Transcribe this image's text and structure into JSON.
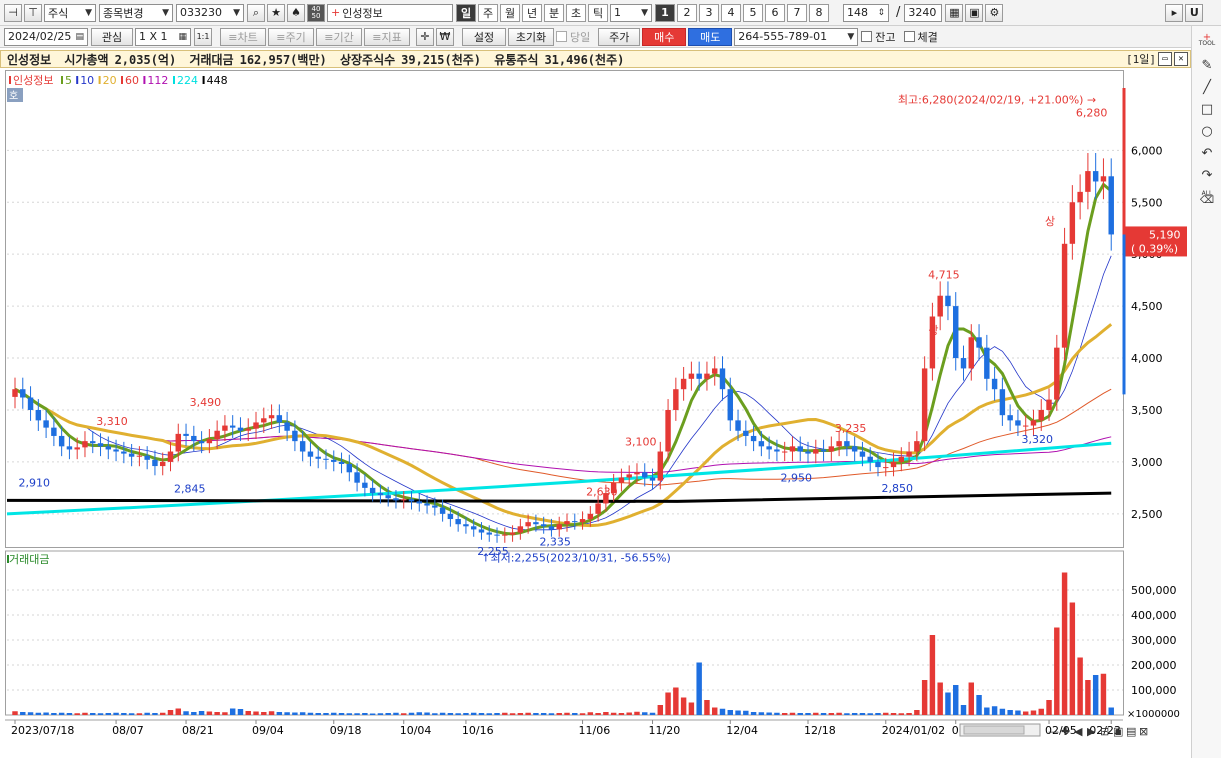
{
  "toolbar1": {
    "market_type": "주식",
    "change_item": "종목변경",
    "code": "033230",
    "stock_name": "인성정보",
    "ratio_icon_top": "40",
    "ratio_icon_bottom": "50",
    "periods": [
      "일",
      "주",
      "월",
      "년",
      "분",
      "초",
      "틱"
    ],
    "period_value": "1",
    "nums": [
      "1",
      "2",
      "3",
      "4",
      "5",
      "6",
      "7",
      "8"
    ],
    "count": "148",
    "slash": "/",
    "total": "3240",
    "u_button": "U"
  },
  "toolbar2": {
    "date": "2024/02/25",
    "interest": "관심",
    "layout": "1 X 1",
    "one_to_one": "1:1",
    "chart_btn": "≡차트",
    "period_btn": "≡주기",
    "range_btn": "≡기간",
    "indicator_btn": "≡지표",
    "won": "₩",
    "setting": "설정",
    "reset": "초기화",
    "sameday": "당일",
    "price": "주가",
    "buy": "매수",
    "sell": "매도",
    "account": "264-555-789-01",
    "balance": "잔고",
    "executed": "체결"
  },
  "infobar": {
    "name": "인성정보",
    "cap_label": "시가총액",
    "cap_value": "2,035(억)",
    "trade_label": "거래대금",
    "trade_value": "162,957(백만)",
    "listed_label": "상장주식수",
    "listed_value": "39,215(천주)",
    "float_label": "유통주식",
    "float_value": "31,496(천주)",
    "period_tag": "[1일]"
  },
  "chart_data": [
    {
      "type": "candlestick",
      "title": "인성정보",
      "legend": [
        "인성정보",
        "5",
        "10",
        "20",
        "60",
        "112",
        "224",
        "448"
      ],
      "ylim": [
        2200,
        6600
      ],
      "y_ticks": [
        2500,
        3000,
        3500,
        4000,
        4500,
        5000,
        5500,
        6000
      ],
      "x_labels": [
        "2023/07/18",
        "08/07",
        "08/21",
        "09/04",
        "09/18",
        "10/04",
        "10/16",
        "11/06",
        "11/20",
        "12/04",
        "12/18",
        "2024/01/02",
        "01/15",
        "02/05",
        "02/23"
      ],
      "annotations": [
        {
          "text": "최고:6,280(2024/02/19, +21.00%)",
          "color": "red"
        },
        {
          "text": "최저:2,255(2023/10/31, -56.55%)",
          "color": "blue"
        },
        {
          "text": "3,310",
          "color": "red"
        },
        {
          "text": "3,490",
          "color": "red"
        },
        {
          "text": "2,910",
          "color": "blue"
        },
        {
          "text": "2,845",
          "color": "blue"
        },
        {
          "text": "2,630",
          "color": "red"
        },
        {
          "text": "2,255",
          "color": "blue"
        },
        {
          "text": "2,335",
          "color": "blue"
        },
        {
          "text": "3,100",
          "color": "red"
        },
        {
          "text": "3,235",
          "color": "red"
        },
        {
          "text": "2,950",
          "color": "blue"
        },
        {
          "text": "2,850",
          "color": "blue"
        },
        {
          "text": "4,715",
          "color": "red"
        },
        {
          "text": "3,320",
          "color": "blue"
        },
        {
          "text": "6,280",
          "color": "red"
        },
        {
          "text": "상",
          "color": "red"
        }
      ],
      "current_price": "5,190",
      "current_change": "( 0.39%)",
      "series_close": [
        3700,
        3620,
        3500,
        3400,
        3330,
        3250,
        3150,
        3120,
        3140,
        3200,
        3180,
        3150,
        3120,
        3100,
        3080,
        3050,
        3060,
        3020,
        2960,
        3000,
        3100,
        3270,
        3250,
        3200,
        3180,
        3220,
        3300,
        3350,
        3330,
        3300,
        3320,
        3380,
        3420,
        3450,
        3380,
        3300,
        3200,
        3100,
        3050,
        3030,
        3020,
        3000,
        2980,
        2900,
        2800,
        2750,
        2700,
        2680,
        2650,
        2630,
        2640,
        2620,
        2600,
        2580,
        2560,
        2500,
        2450,
        2400,
        2380,
        2350,
        2320,
        2300,
        2290,
        2300,
        2320,
        2380,
        2420,
        2400,
        2380,
        2350,
        2400,
        2430,
        2420,
        2450,
        2500,
        2600,
        2700,
        2800,
        2850,
        2880,
        2900,
        2850,
        2820,
        3100,
        3500,
        3700,
        3800,
        3850,
        3800,
        3850,
        3900,
        3700,
        3400,
        3300,
        3250,
        3200,
        3150,
        3120,
        3100,
        3100,
        3150,
        3100,
        3080,
        3120,
        3100,
        3150,
        3200,
        3150,
        3100,
        3050,
        3000,
        2950,
        2950,
        3000,
        3050,
        3100,
        3200,
        3900,
        4400,
        4600,
        4500,
        4000,
        3900,
        4200,
        4100,
        3800,
        3700,
        3450,
        3400,
        3350,
        3350,
        3400,
        3500,
        3600,
        4100,
        5100,
        5500,
        5600,
        5800,
        5700,
        5750,
        5190
      ],
      "volume_ylim": [
        0,
        600000
      ],
      "volume_ticks": [
        100000,
        200000,
        300000,
        400000,
        500000
      ],
      "volume_unit": "×1000000",
      "volume": [
        15000,
        12000,
        11000,
        9000,
        10000,
        8000,
        9000,
        8000,
        7000,
        9000,
        8000,
        7000,
        8000,
        9000,
        8000,
        7000,
        7000,
        9000,
        8000,
        9000,
        20000,
        26000,
        15000,
        12000,
        16000,
        14000,
        12000,
        11000,
        26000,
        24000,
        16000,
        14000,
        12000,
        15000,
        12000,
        11000,
        10000,
        11000,
        9000,
        8000,
        8000,
        9000,
        8000,
        7000,
        7000,
        8000,
        6000,
        7000,
        8000,
        9000,
        7000,
        9000,
        11000,
        10000,
        7000,
        9000,
        8000,
        7000,
        8000,
        9000,
        8000,
        7000,
        8000,
        9000,
        7000,
        8000,
        9000,
        8000,
        8000,
        7000,
        8000,
        9000,
        8000,
        7000,
        11000,
        8000,
        12000,
        9000,
        8000,
        10000,
        13000,
        11000,
        9000,
        40000,
        90000,
        110000,
        70000,
        50000,
        210000,
        60000,
        30000,
        25000,
        20000,
        18000,
        17000,
        12000,
        11000,
        10000,
        9000,
        8000,
        9000,
        8000,
        8000,
        9000,
        8000,
        8000,
        9000,
        7000,
        8000,
        8000,
        7000,
        8000,
        9000,
        8000,
        7000,
        8000,
        20000,
        140000,
        320000,
        130000,
        90000,
        120000,
        40000,
        130000,
        80000,
        30000,
        35000,
        25000,
        20000,
        18000,
        14000,
        18000,
        25000,
        60000,
        350000,
        570000,
        450000,
        230000,
        140000,
        160000,
        165000,
        30000
      ]
    }
  ],
  "volume_panel": {
    "title": "거래대금"
  },
  "right_tools": {
    "tool_label": "TOOL",
    "all_label": "ALL"
  }
}
